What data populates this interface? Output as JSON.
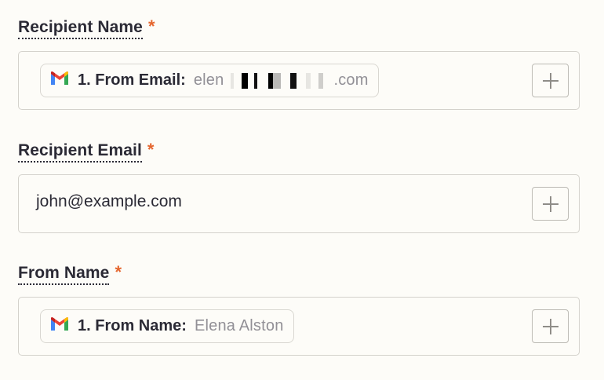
{
  "fields": [
    {
      "label": "Recipient Name",
      "required_mark": "*",
      "pill": {
        "icon": "gmail-icon",
        "label": "1. From Email:",
        "value_prefix": "elen",
        "value_suffix": ".com"
      }
    },
    {
      "label": "Recipient Email",
      "required_mark": "*",
      "value": "john@example.com"
    },
    {
      "label": "From Name",
      "required_mark": "*",
      "pill": {
        "icon": "gmail-icon",
        "label": "1. From Name:",
        "value": "Elena Alston"
      }
    }
  ],
  "colors": {
    "required": "#e5662f",
    "text": "#2b2a35",
    "muted": "#929096",
    "border": "#d4d2cc",
    "background": "#fdfcf8"
  }
}
